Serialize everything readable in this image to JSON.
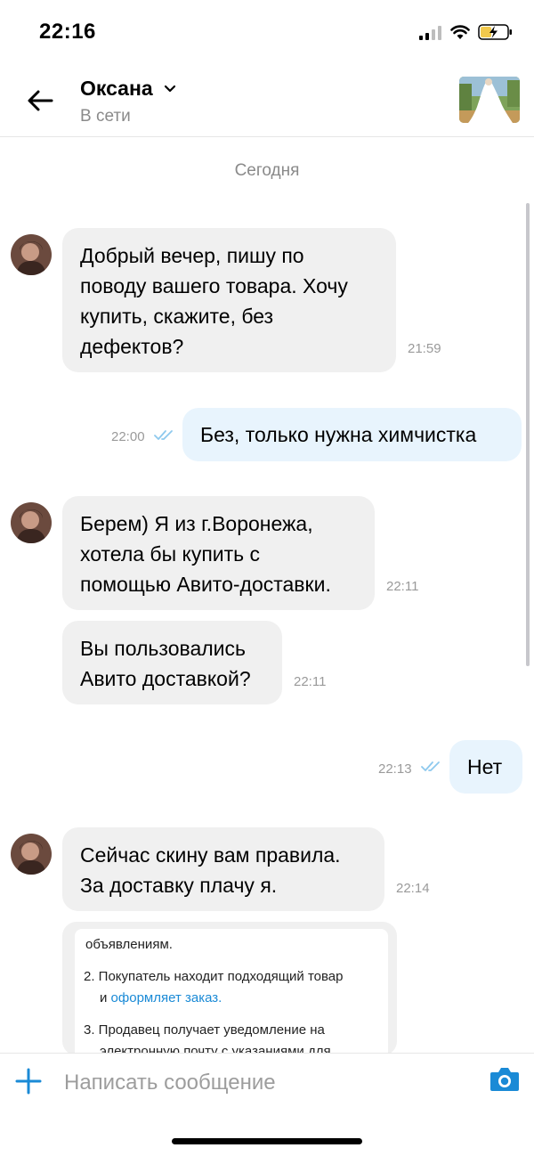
{
  "status_bar": {
    "time": "22:16"
  },
  "header": {
    "contact_name": "Оксана",
    "contact_status": "В сети"
  },
  "chat": {
    "date_separator": "Сегодня",
    "messages": [
      {
        "direction": "in",
        "lines": [
          "Добрый вечер, пишу по",
          "поводу вашего товара. Хочу",
          "купить, скажите, без",
          "дефектов?"
        ],
        "time": "21:59"
      },
      {
        "direction": "out",
        "lines": [
          "Без, только нужна химчистка"
        ],
        "time": "22:00",
        "read": true
      },
      {
        "direction": "in",
        "lines": [
          "Берем) Я из г.Воронежа,",
          "хотела бы купить с",
          "помощью Авито-доставки."
        ],
        "time": "22:11"
      },
      {
        "direction": "in",
        "lines": [
          "Вы пользовались",
          "Авито доставкой?"
        ],
        "time": "22:11"
      },
      {
        "direction": "out",
        "lines": [
          "Нет"
        ],
        "time": "22:13",
        "read": true
      },
      {
        "direction": "in",
        "lines": [
          "Сейчас скину вам правила.",
          "За доставку плачу я."
        ],
        "time": "22:14"
      }
    ],
    "attachment": {
      "line_1": "объявлениям.",
      "item_2_prefix": "2. Покупатель находит подходящий товар",
      "item_2_continuation": "и ",
      "item_2_link": "оформляет заказ.",
      "item_3": "3. Продавец получает уведомление на",
      "item_3_continuation": "электронную почту с указаниями для"
    }
  },
  "composer": {
    "placeholder": "Написать сообщение"
  },
  "colors": {
    "incoming_bubble": "#f0f0f0",
    "outgoing_bubble": "#e8f4fd",
    "accent": "#1a8ad6",
    "read_ticks": "#8ec9ee"
  }
}
